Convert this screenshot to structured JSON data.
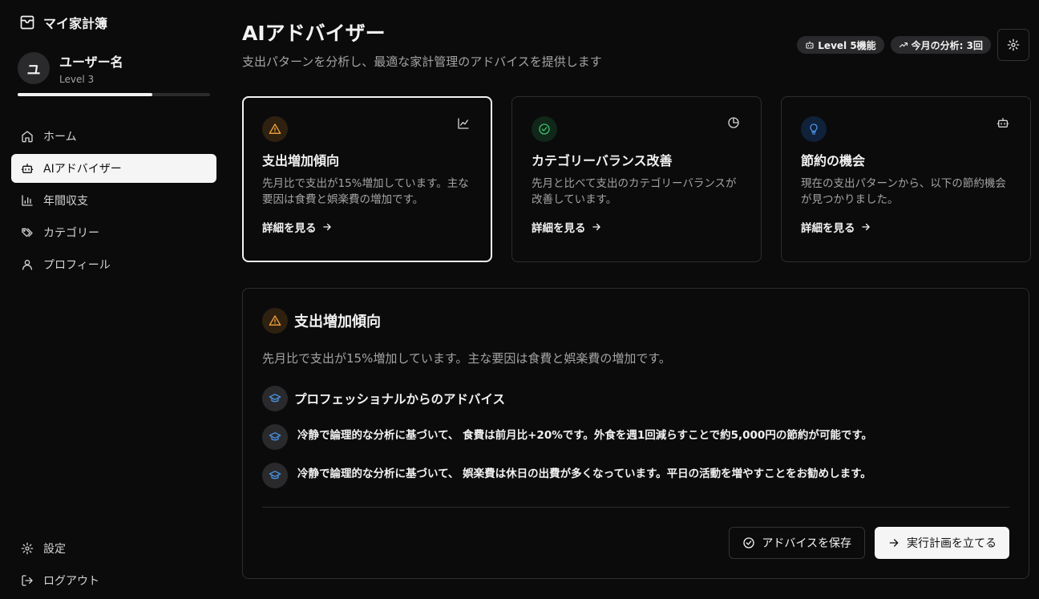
{
  "app": {
    "name": "マイ家計簿"
  },
  "user": {
    "initial": "ユ",
    "name": "ユーザー名",
    "level": "Level 3",
    "level_progress": 0.7
  },
  "nav": {
    "items": [
      {
        "label": "ホーム",
        "icon": "home-icon"
      },
      {
        "label": "AIアドバイザー",
        "icon": "bot-icon"
      },
      {
        "label": "年間収支",
        "icon": "bar-chart-icon"
      },
      {
        "label": "カテゴリー",
        "icon": "tags-icon"
      },
      {
        "label": "プロフィール",
        "icon": "user-icon"
      }
    ],
    "active_index": 1,
    "settings_label": "設定",
    "logout_label": "ログアウト"
  },
  "header": {
    "title": "AIアドバイザー",
    "subtitle": "支出パターンを分析し、最適な家計管理のアドバイスを提供します",
    "badge_level": "Level 5機能",
    "badge_analysis": "今月の分析: 3回"
  },
  "cards": [
    {
      "title": "支出増加傾向",
      "desc": "先月比で支出が15%増加しています。主な要因は食費と娯楽費の増加です。",
      "link": "詳細を見る",
      "icon": "alert-triangle-icon",
      "corner_icon": "line-chart-icon",
      "accent": "#f0a03c",
      "selected": true
    },
    {
      "title": "カテゴリーバランス改善",
      "desc": "先月と比べて支出のカテゴリーバランスが改善しています。",
      "link": "詳細を見る",
      "icon": "check-circle-icon",
      "corner_icon": "pie-chart-icon",
      "accent": "#3fbf6a",
      "selected": false
    },
    {
      "title": "節約の機会",
      "desc": "現在の支出パターンから、以下の節約機会が見つかりました。",
      "link": "詳細を見る",
      "icon": "lightbulb-icon",
      "corner_icon": "bot-icon",
      "accent": "#4a90e2",
      "selected": false
    }
  ],
  "detail": {
    "title": "支出増加傾向",
    "desc": "先月比で支出が15%増加しています。主な要因は食費と娯楽費の増加です。",
    "advice_title": "プロフェッショナルからのアドバイス",
    "advice": [
      "冷静で論理的な分析に基づいて、 食費は前月比+20%です。外食を週1回減らすことで約5,000円の節約が可能です。",
      "冷静で論理的な分析に基づいて、 娯楽費は休日の出費が多くなっています。平日の活動を増やすことをお勧めします。"
    ],
    "save_label": "アドバイスを保存",
    "plan_label": "実行計画を立てる"
  }
}
